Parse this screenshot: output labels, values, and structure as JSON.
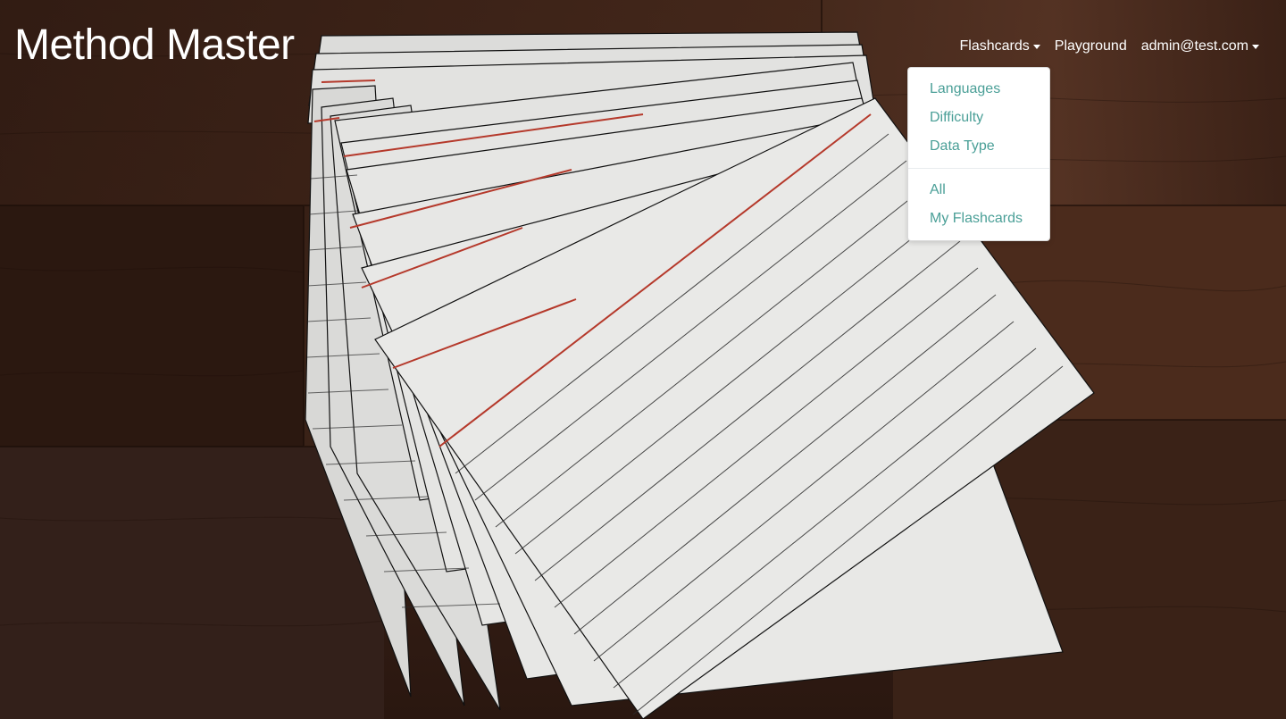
{
  "brand": {
    "title": "Method Master"
  },
  "nav": {
    "flashcards_label": "Flashcards",
    "playground_label": "Playground",
    "user_label": "admin@test.com"
  },
  "dropdown": {
    "group1": [
      "Languages",
      "Difficulty",
      "Data Type"
    ],
    "group2": [
      "All",
      "My Flashcards"
    ]
  },
  "background": {
    "subject": "index-cards-on-wood",
    "wood_color": "#3a2218",
    "card_color": "#e6e6e4",
    "accent_line_color": "#b5392b"
  },
  "colors": {
    "link": "#4a9f97",
    "nav_text": "#ffffff"
  }
}
